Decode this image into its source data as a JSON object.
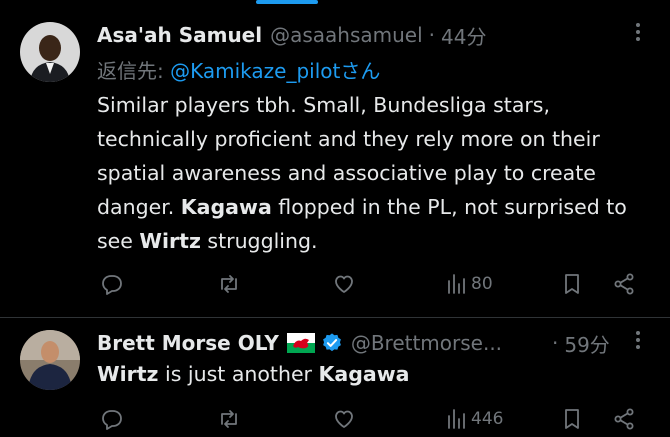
{
  "posts": [
    {
      "display_name": "Asa'ah Samuel",
      "handle": "@asaahsamuel",
      "separator": "·",
      "time": "44分",
      "reply_prefix": "返信先: ",
      "reply_to": "@Kamikaze_pilot",
      "reply_suffix": "さん",
      "body": {
        "t1": "Similar players tbh. Small, Bundesliga stars, technically proficient and they rely more on their spatial awareness and associative play to create danger. ",
        "b1": "Kagawa",
        "t2": " flopped in the PL, not surprised to see ",
        "b2": "Wirtz",
        "t3": " struggling."
      },
      "views": "80"
    },
    {
      "display_name": "Brett Morse OLY",
      "handle": "@Brettmorse...",
      "separator": "·",
      "time": "59分",
      "body": {
        "b1": "Wirtz",
        "t1": " is just another ",
        "b2": "Kagawa"
      },
      "views": "446"
    }
  ],
  "colors": {
    "background": "#000000",
    "text": "#e7e9ea",
    "muted": "#71767b",
    "accent": "#1d9bf0",
    "divider": "#2f3336"
  },
  "icons": [
    "more-icon",
    "reply-icon",
    "repost-icon",
    "like-icon",
    "views-icon",
    "bookmark-icon",
    "share-icon",
    "wales-flag-icon",
    "verified-icon"
  ]
}
